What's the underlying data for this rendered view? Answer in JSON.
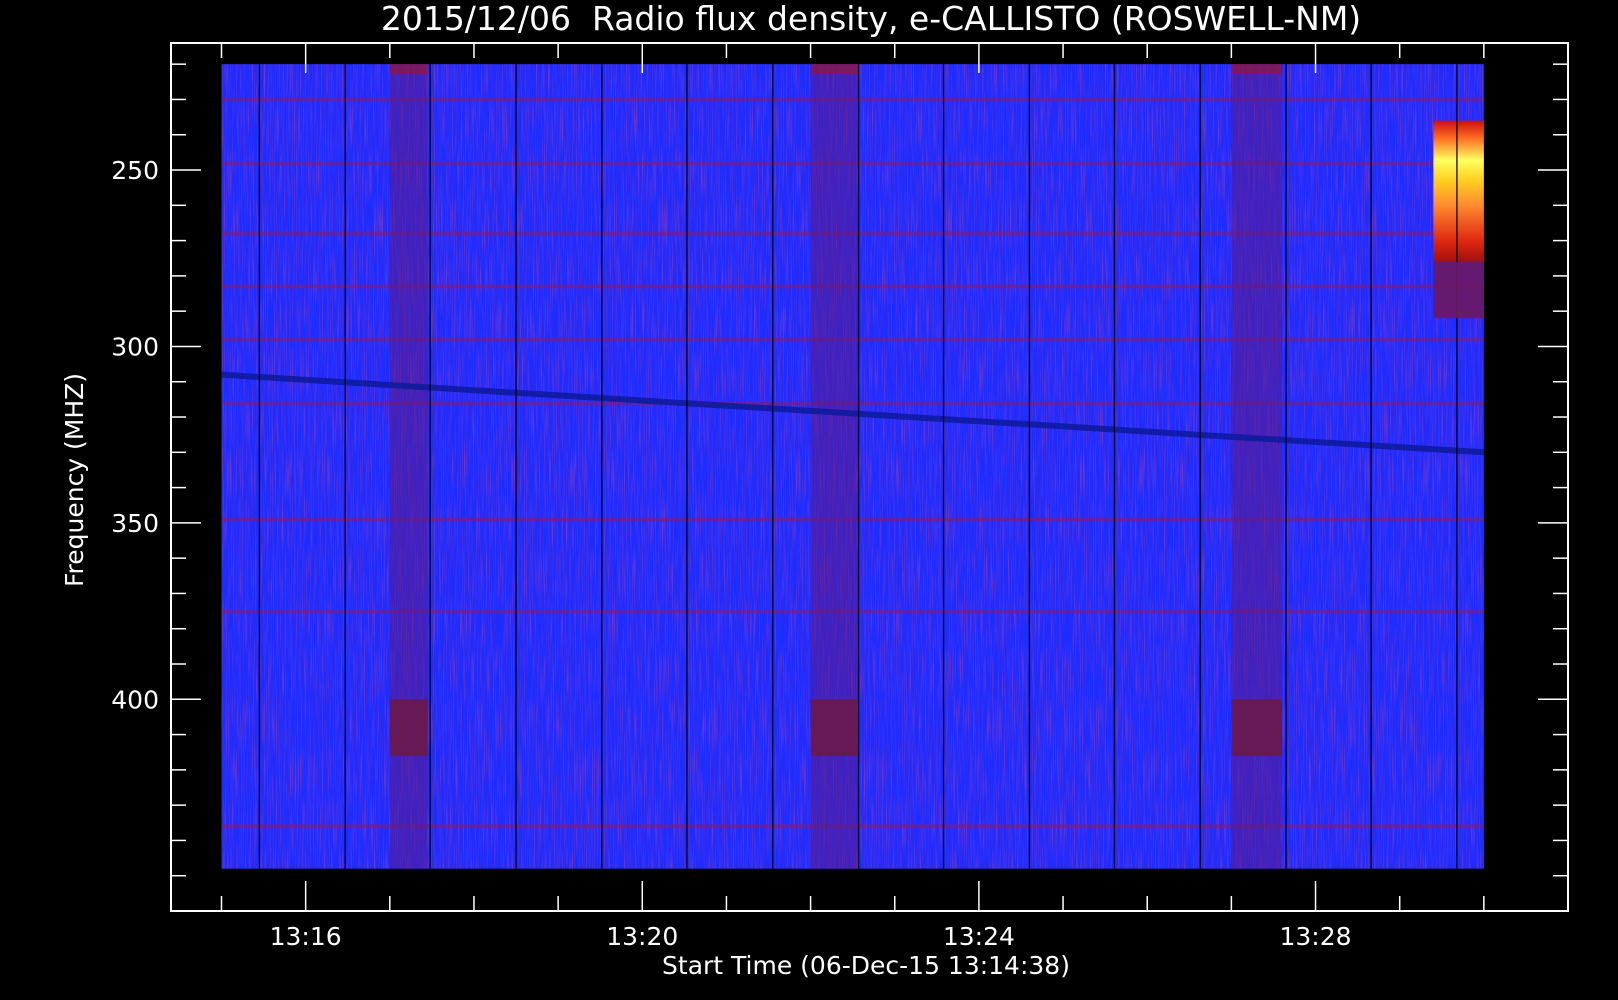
{
  "chart_data": {
    "type": "heatmap",
    "title": "2015/12/06  Radio flux density, e-CALLISTO (ROSWELL-NM)",
    "xlabel": "Start Time (06-Dec-15 13:14:38)",
    "ylabel": "Frequency (MHZ)",
    "x_unit": "minutes after 13:00 UT",
    "xlim": [
      14.4,
      31.0
    ],
    "ylim": [
      460,
      214
    ],
    "data_range": {
      "time": [
        "13:15",
        "13:30"
      ],
      "frequency_mhz": [
        220,
        448
      ]
    },
    "y_major_ticks": [
      250,
      300,
      350,
      400
    ],
    "y_tick_labels": [
      "250",
      "300",
      "350",
      "400"
    ],
    "y_minor_step": 10,
    "x_major_ticks": [
      16,
      20,
      24,
      28
    ],
    "x_tick_labels": [
      "13:16",
      "13:20",
      "13:24",
      "13:28"
    ],
    "x_minor_step": 1,
    "background_color": "#1e2cff",
    "colormap": [
      "#0a0aa0",
      "#1e2cff",
      "#6a1a80",
      "#a01818",
      "#e02810",
      "#ff7020",
      "#ffd020",
      "#ffff60"
    ],
    "scan_boundaries": [
      15.45,
      16.47,
      17.48,
      18.5,
      19.52,
      20.53,
      21.55,
      22.57,
      23.58,
      24.6,
      25.61,
      26.63,
      27.65,
      28.66,
      29.68
    ],
    "calibration_blocks": [
      {
        "t_start": 17.0,
        "t_end": 17.45
      },
      {
        "t_start": 22.0,
        "t_end": 22.55
      },
      {
        "t_start": 27.0,
        "t_end": 27.6
      }
    ],
    "interference_bands_mhz": [
      230,
      248,
      268,
      283,
      298,
      316,
      349,
      375,
      436
    ],
    "drift_feature": {
      "time": [
        15.0,
        30.0
      ],
      "frequency_mhz": [
        308,
        330
      ]
    },
    "burst": {
      "t_start": 29.4,
      "t_end": 30.0,
      "frequency_mhz": [
        236,
        276
      ]
    }
  }
}
